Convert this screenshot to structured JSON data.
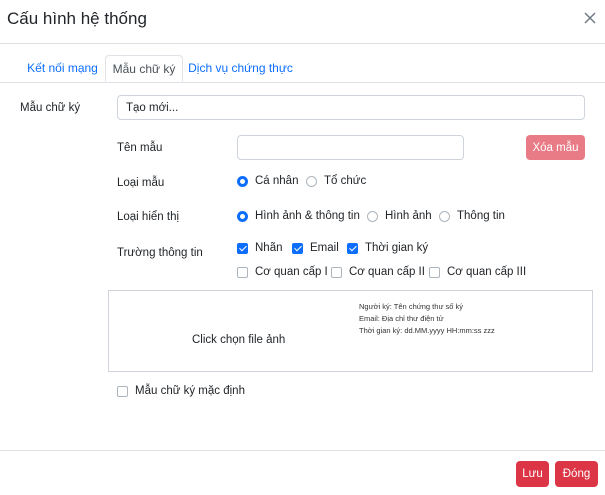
{
  "dialog": {
    "title": "Cấu hình hệ thống",
    "close_icon": "close-icon"
  },
  "tabs": [
    {
      "label": "Kết nối mạng",
      "active": false
    },
    {
      "label": "Mẫu chữ ký",
      "active": true
    },
    {
      "label": "Dịch vụ chứng thực",
      "active": false
    }
  ],
  "form": {
    "template_label": "Mẫu chữ ký",
    "template_value": "Tạo mới...",
    "name_label": "Tên mẫu",
    "name_value": "",
    "delete_button": "Xóa mẫu",
    "type_label": "Loại mẫu",
    "type_options": [
      {
        "label": "Cá nhân",
        "checked": true
      },
      {
        "label": "Tổ chức",
        "checked": false
      }
    ],
    "display_label": "Loại hiển thị",
    "display_options": [
      {
        "label": "Hình ảnh & thông tin",
        "checked": true
      },
      {
        "label": "Hình ảnh",
        "checked": false
      },
      {
        "label": "Thông tin",
        "checked": false
      }
    ],
    "fields_label": "Trường thông tin",
    "fields_row1": [
      {
        "label": "Nhãn",
        "checked": true
      },
      {
        "label": "Email",
        "checked": true
      },
      {
        "label": "Thời gian ký",
        "checked": true
      }
    ],
    "fields_row2": [
      {
        "label": "Cơ quan cấp I",
        "checked": false
      },
      {
        "label": "Cơ quan cấp II",
        "checked": false
      },
      {
        "label": "Cơ quan cấp III",
        "checked": false
      }
    ],
    "dropzone_text": "Click chọn file ảnh",
    "preview_lines": [
      "Người ký: Tên chứng thư số ký",
      "Email: Địa chỉ thư điện tử",
      "Thời gian ký: dd.MM.yyyy HH:mm:ss zzz"
    ],
    "default_label": "Mẫu chữ ký mặc định",
    "default_checked": false
  },
  "footer": {
    "save_button": "Lưu",
    "close_button": "Đóng"
  },
  "colors": {
    "primary": "#0d6efd",
    "danger": "#dc3545",
    "danger_light": "#e87b85"
  }
}
